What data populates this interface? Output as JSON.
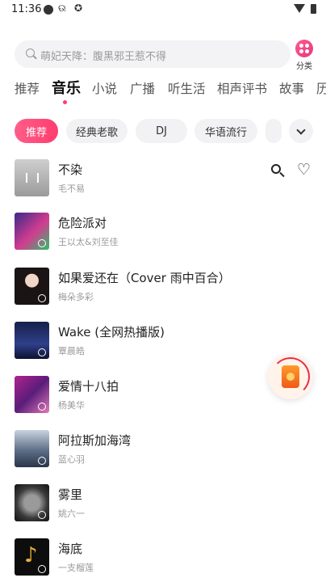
{
  "status_bar": {
    "time": "11:36",
    "weibo": "ଉ",
    "misc": "✪"
  },
  "search": {
    "placeholder": "萌妃天降：腹黑邪王惹不得"
  },
  "category_button": {
    "label": "分类"
  },
  "tabs": [
    {
      "label": "推荐"
    },
    {
      "label": "音乐",
      "active": true
    },
    {
      "label": "小说"
    },
    {
      "label": "广播"
    },
    {
      "label": "听生活"
    },
    {
      "label": "相声评书"
    },
    {
      "label": "故事"
    },
    {
      "label": "历"
    }
  ],
  "chips": [
    {
      "label": "推荐",
      "active": true
    },
    {
      "label": "经典老歌"
    },
    {
      "label": "DJ"
    },
    {
      "label": "华语流行"
    }
  ],
  "songs": [
    {
      "title": "不染",
      "artist": "毛不易",
      "cover_icon": "album-cover-icon"
    },
    {
      "title": "危险派对",
      "artist": "王以太&刘至佳",
      "cover_icon": "album-cover-icon"
    },
    {
      "title": "如果爱还在（Cover 雨中百合）",
      "artist": "梅朵多彩",
      "cover_icon": "album-cover-icon"
    },
    {
      "title": "Wake (全网热播版)",
      "artist": "覃晨皓",
      "cover_icon": "album-cover-icon"
    },
    {
      "title": "爱情十八拍",
      "artist": "杨美华",
      "cover_icon": "album-cover-icon"
    },
    {
      "title": "阿拉斯加海湾",
      "artist": "蓝心羽",
      "cover_icon": "album-cover-icon"
    },
    {
      "title": "雾里",
      "artist": "姚六一",
      "cover_icon": "album-cover-icon"
    },
    {
      "title": "海底",
      "artist": "一支榴莲",
      "cover_icon": "album-cover-icon"
    }
  ],
  "icons": {
    "search": "search-icon",
    "favorite": "heart-icon",
    "more": "chevron-down-icon",
    "category": "grid-icon",
    "floating": "reward-icon"
  },
  "colors": {
    "accent": "#ff3d6e",
    "chip_bg": "#f2f2f4",
    "search_bg": "#f3f3f5"
  }
}
